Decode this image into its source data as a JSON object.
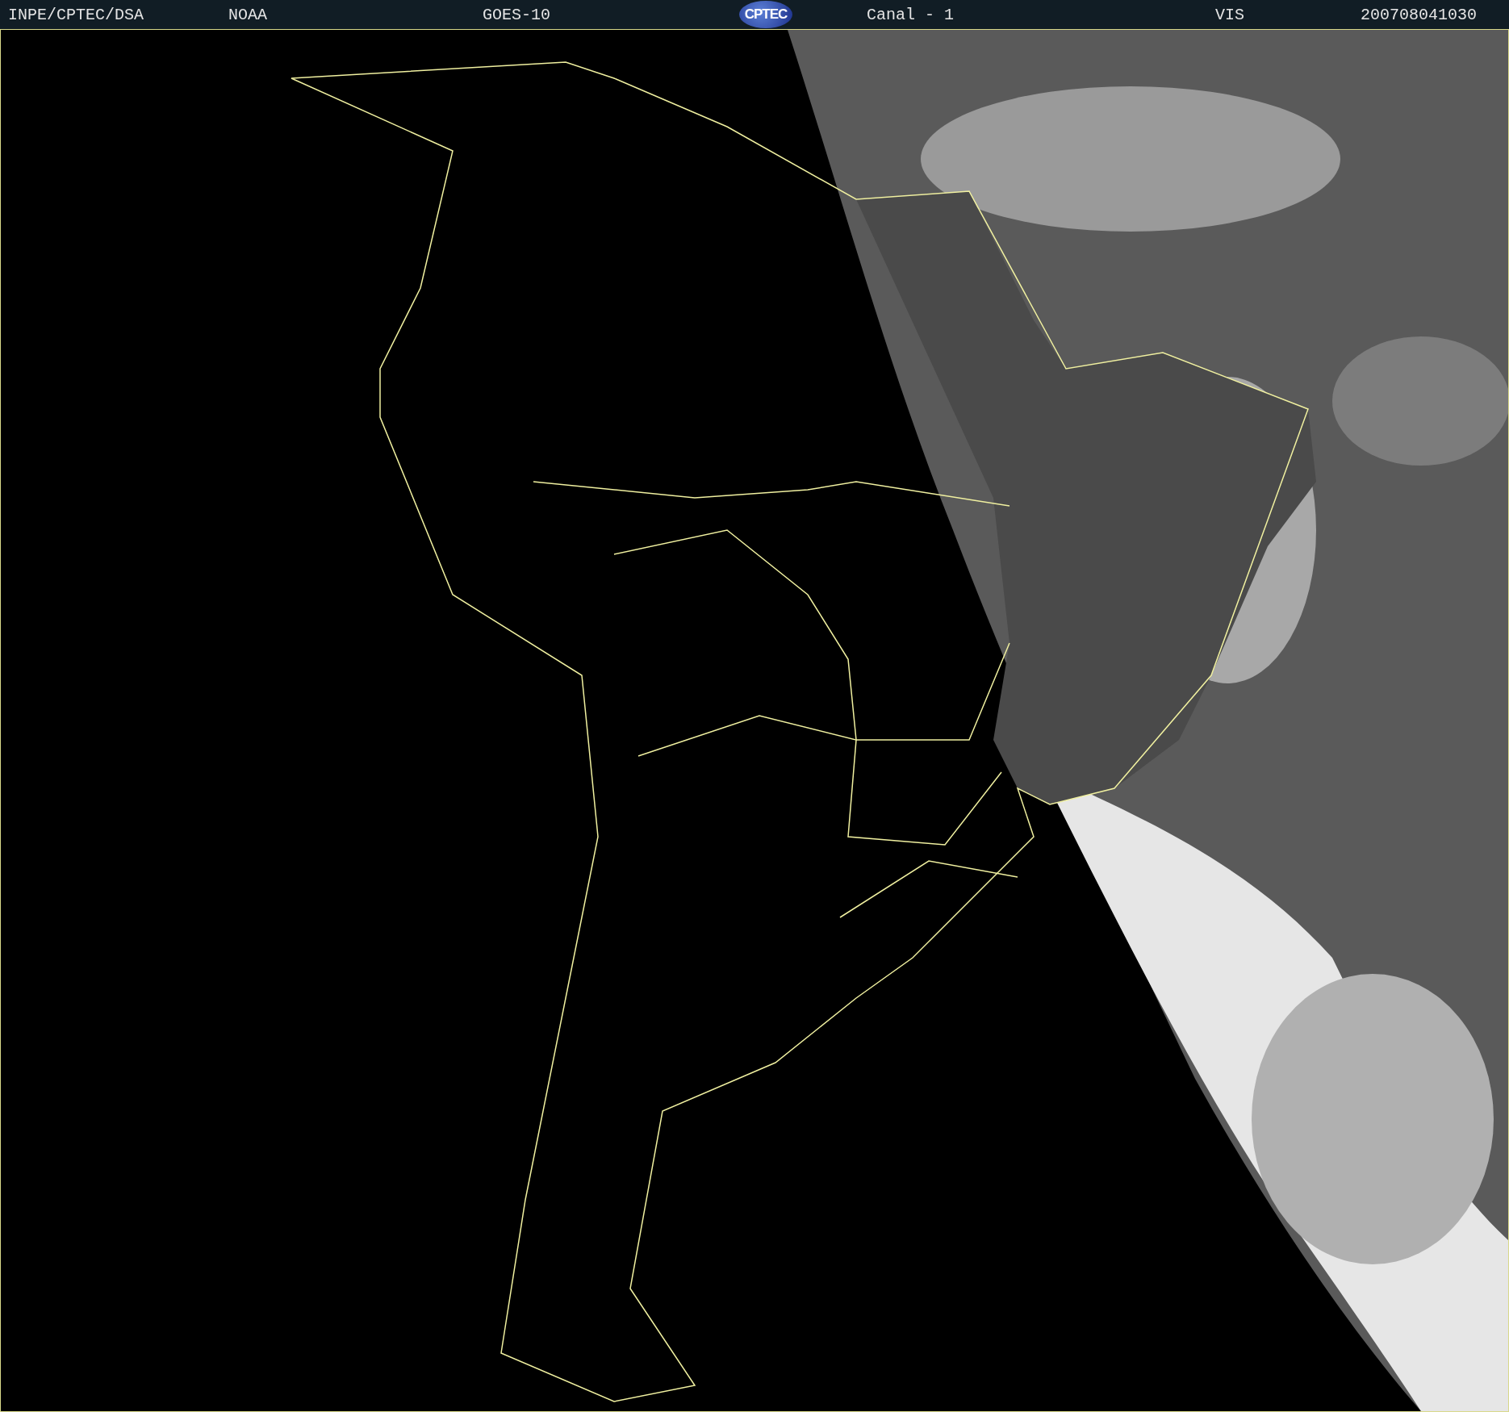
{
  "header": {
    "source": "INPE/CPTEC/DSA",
    "agency": "NOAA",
    "satellite": "GOES-10",
    "logo": "CPTEC",
    "channel": "Canal - 1",
    "band": "VIS",
    "timestamp": "200708041030"
  }
}
